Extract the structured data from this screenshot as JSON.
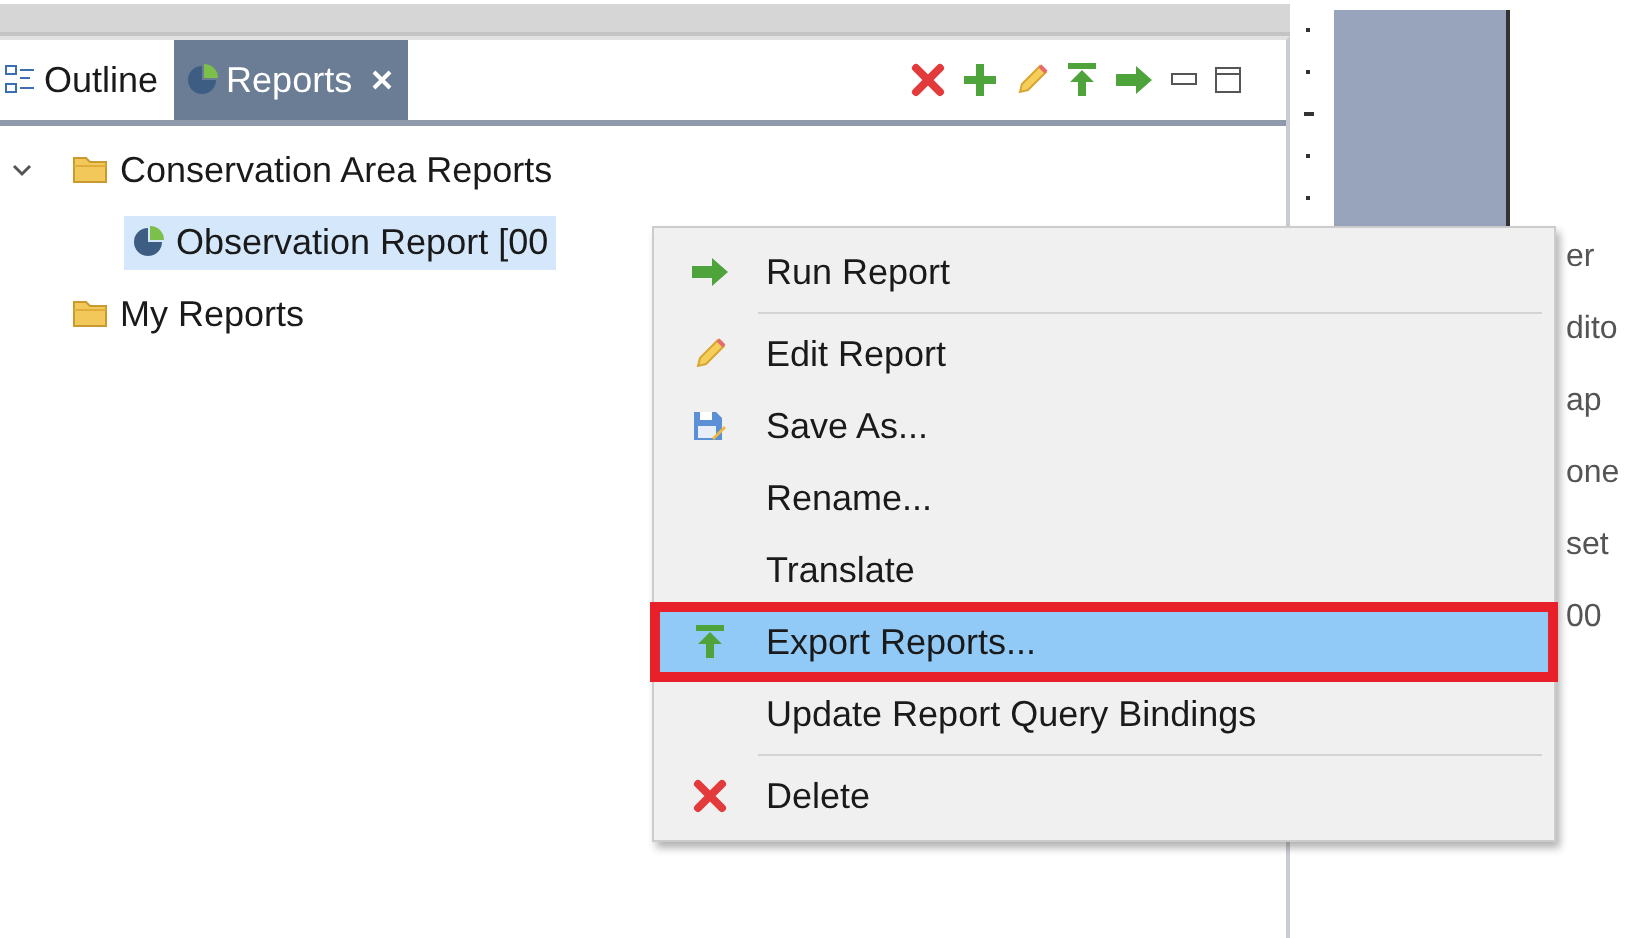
{
  "tabs": [
    {
      "label": "Outline",
      "kind": "outline",
      "selected": false
    },
    {
      "label": "Reports",
      "kind": "report",
      "selected": true
    }
  ],
  "toolbar": [
    {
      "kind": "delete"
    },
    {
      "kind": "add"
    },
    {
      "kind": "edit"
    },
    {
      "kind": "export"
    },
    {
      "kind": "run"
    },
    {
      "kind": "minimize"
    },
    {
      "kind": "maximize"
    }
  ],
  "tree": [
    {
      "label": "Conservation Area Reports",
      "kind": "folder",
      "expanded": true,
      "selected": false,
      "children": [
        {
          "label": "Observation Report [00",
          "kind": "report",
          "selected": true
        }
      ]
    },
    {
      "label": "My Reports",
      "kind": "folder",
      "selected": false
    }
  ],
  "right_panel": {
    "fragments": [
      "er",
      "dito",
      "ap",
      "one",
      "set",
      "00"
    ]
  },
  "context_menu": {
    "items": [
      {
        "kind": "run",
        "label": "Run Report",
        "selected": false
      },
      {
        "kind": "separator"
      },
      {
        "kind": "edit",
        "label": "Edit Report",
        "selected": false
      },
      {
        "kind": "save",
        "label": "Save As...",
        "selected": false
      },
      {
        "kind": "plain",
        "label": "Rename...",
        "selected": false
      },
      {
        "kind": "plain",
        "label": "Translate",
        "selected": false
      },
      {
        "kind": "export",
        "label": "Export Reports...",
        "selected": true
      },
      {
        "kind": "plain",
        "label": "Update Report Query Bindings",
        "selected": false
      },
      {
        "kind": "separator"
      },
      {
        "kind": "delete",
        "label": "Delete",
        "selected": false
      }
    ]
  }
}
